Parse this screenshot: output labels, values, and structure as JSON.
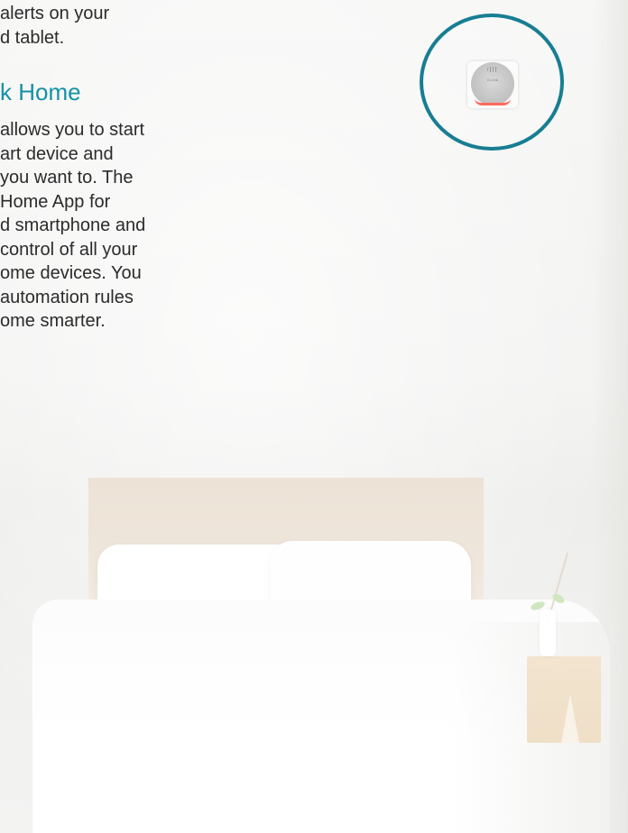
{
  "intro_paragraph": {
    "lines": [
      "alerts on your",
      "d tablet."
    ]
  },
  "section": {
    "heading": "k Home",
    "lines": [
      "allows you to start",
      "art device and",
      "you want to. The",
      "Home App for",
      "d smartphone and",
      "control of all your",
      "ome devices. You",
      "automation rules",
      "ome smarter."
    ]
  },
  "device_callout": {
    "brand_text": "D-Link",
    "ring_color": "#177e92",
    "led_color": "#ff6a5c"
  },
  "colors": {
    "heading": "#1392a5",
    "body_text": "#2b2b2b"
  }
}
